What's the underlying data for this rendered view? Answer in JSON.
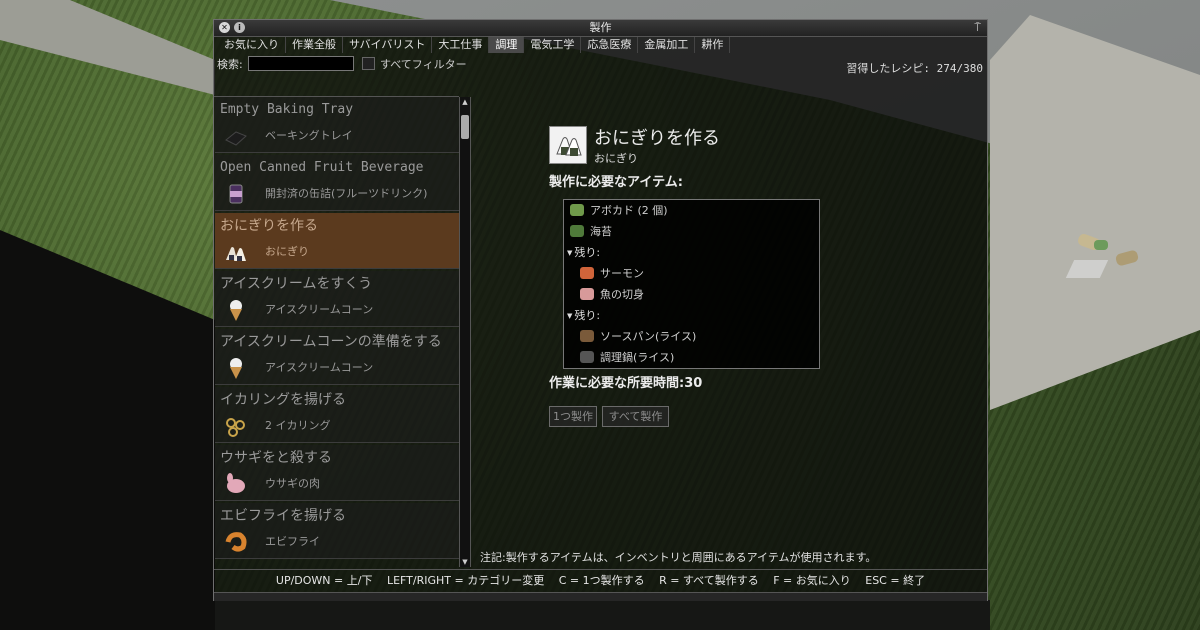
{
  "window": {
    "title": "製作",
    "close_glyph": "✕",
    "info_glyph": "i",
    "pin_glyph": "⍑"
  },
  "tabs": [
    {
      "label": "お気に入り"
    },
    {
      "label": "作業全般"
    },
    {
      "label": "サバイバリスト"
    },
    {
      "label": "大工仕事"
    },
    {
      "label": "調理",
      "active": true
    },
    {
      "label": "電気工学"
    },
    {
      "label": "応急医療"
    },
    {
      "label": "金属加工"
    },
    {
      "label": "耕作"
    }
  ],
  "search": {
    "label": "検索:",
    "value": "",
    "filter_label": "すべてフィルター"
  },
  "learned_recipes": "習得したレシピ: 274/380",
  "recipes": [
    {
      "name": "Empty Baking Tray",
      "result": "ベーキングトレイ",
      "icon": "baking-tray-icon"
    },
    {
      "name": "Open Canned Fruit Beverage",
      "result": "開封済の缶詰(フルーツドリンク)",
      "icon": "canned-drink-icon"
    },
    {
      "name": "おにぎりを作る",
      "result": "おにぎり",
      "icon": "onigiri-icon",
      "selected": true
    },
    {
      "name": "アイスクリームをすくう",
      "result": "アイスクリームコーン",
      "icon": "ice-cream-cone-icon"
    },
    {
      "name": "アイスクリームコーンの準備をする",
      "result": "アイスクリームコーン",
      "icon": "ice-cream-cone-icon"
    },
    {
      "name": "イカリングを揚げる",
      "result": "2 イカリング",
      "icon": "squid-rings-icon"
    },
    {
      "name": "ウサギをと殺する",
      "result": "ウサギの肉",
      "icon": "rabbit-meat-icon"
    },
    {
      "name": "エビフライを揚げる",
      "result": "エビフライ",
      "icon": "fried-shrimp-icon"
    }
  ],
  "detail": {
    "title": "おにぎりを作る",
    "result": "おにぎり",
    "required_items_heading": "製作に必要なアイテム:",
    "required": [
      {
        "label": "アボカド (2 個)",
        "icon": "avocado-icon",
        "color": "#6f9a4a"
      },
      {
        "label": "海苔",
        "icon": "seaweed-icon",
        "color": "#4f7a3a"
      },
      {
        "label": "残り:",
        "group": true
      },
      {
        "label": "サーモン",
        "icon": "salmon-icon",
        "color": "#d0643a"
      },
      {
        "label": "魚の切身",
        "icon": "fish-fillet-icon",
        "color": "#d89a9a"
      },
      {
        "label": "残り:",
        "group": true
      },
      {
        "label": "ソースパン(ライス)",
        "icon": "saucepan-icon",
        "color": "#7a5a3a"
      },
      {
        "label": "調理鍋(ライス)",
        "icon": "cooking-pot-icon",
        "color": "#555555"
      }
    ],
    "time_label": "作業に必要な所要時間:30",
    "craft_one_label": "1つ製作",
    "craft_all_label": "すべて製作"
  },
  "note": "注記:製作するアイテムは、インベントリと周囲にあるアイテムが使用されます。",
  "hints": "UP/DOWN = 上/下　 LEFT/RIGHT = カテゴリー変更　 C = 1つ製作する　 R = すべて製作する　 F = お気に入り　 ESC = 終了",
  "colors": {
    "selected_row": "#5b3a1e",
    "window_bg": "#0a0a0a"
  }
}
